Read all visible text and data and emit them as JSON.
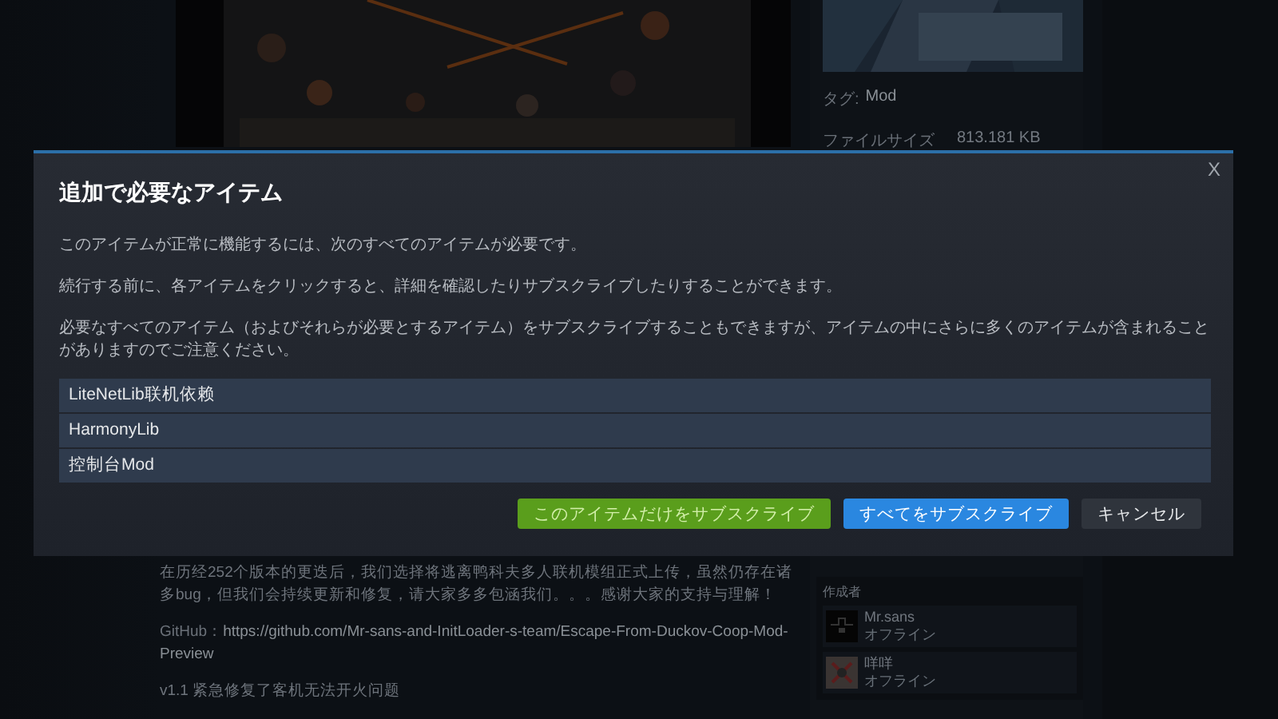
{
  "workshop_item": {
    "tag_label": "タグ:",
    "tag_value": "Mod",
    "file_size_label": "ファイルサイズ",
    "file_size_value": "813.181 KB",
    "description": [
      {
        "kind": "text",
        "text": "在历经252个版本的更迭后，我们选择将逃离鸭科夫多人联机模组正式上传，虽然仍存在诸多bug，但我们会持续更新和修复，请大家多多包涵我们。。。感谢大家的支持与理解！"
      },
      {
        "kind": "link",
        "label": "GitHub：",
        "link": "https://github.com/Mr-sans-and-InitLoader-s-team/Escape-From-Duckov-Coop-Mod-Preview"
      },
      {
        "kind": "text",
        "text": "v1.1 紧急修复了客机无法开火问题"
      }
    ],
    "authors_heading": "作成者",
    "authors": [
      {
        "name": "Mr.sans",
        "status": "オフライン"
      },
      {
        "name": "咩咩",
        "status": "オフライン"
      }
    ]
  },
  "dialog": {
    "title": "追加で必要なアイテム",
    "close": "X",
    "paragraphs": [
      "このアイテムが正常に機能するには、次のすべてのアイテムが必要です。",
      "続行する前に、各アイテムをクリックすると、詳細を確認したりサブスクライブしたりすることができます。",
      "必要なすべてのアイテム（およびそれらが必要とするアイテム）をサブスクライブすることもできますが、アイテムの中にさらに多くのアイテムが含まれることがありますのでご注意ください。"
    ],
    "items": [
      "LiteNetLib联机依赖",
      "HarmonyLib",
      "控制台Mod"
    ],
    "buttons": [
      {
        "label": "このアイテムだけをサブスクライブ",
        "kind": "green"
      },
      {
        "label": "すべてをサブスクライブ",
        "kind": "blue"
      },
      {
        "label": "キャンセル",
        "kind": "plain"
      }
    ]
  }
}
